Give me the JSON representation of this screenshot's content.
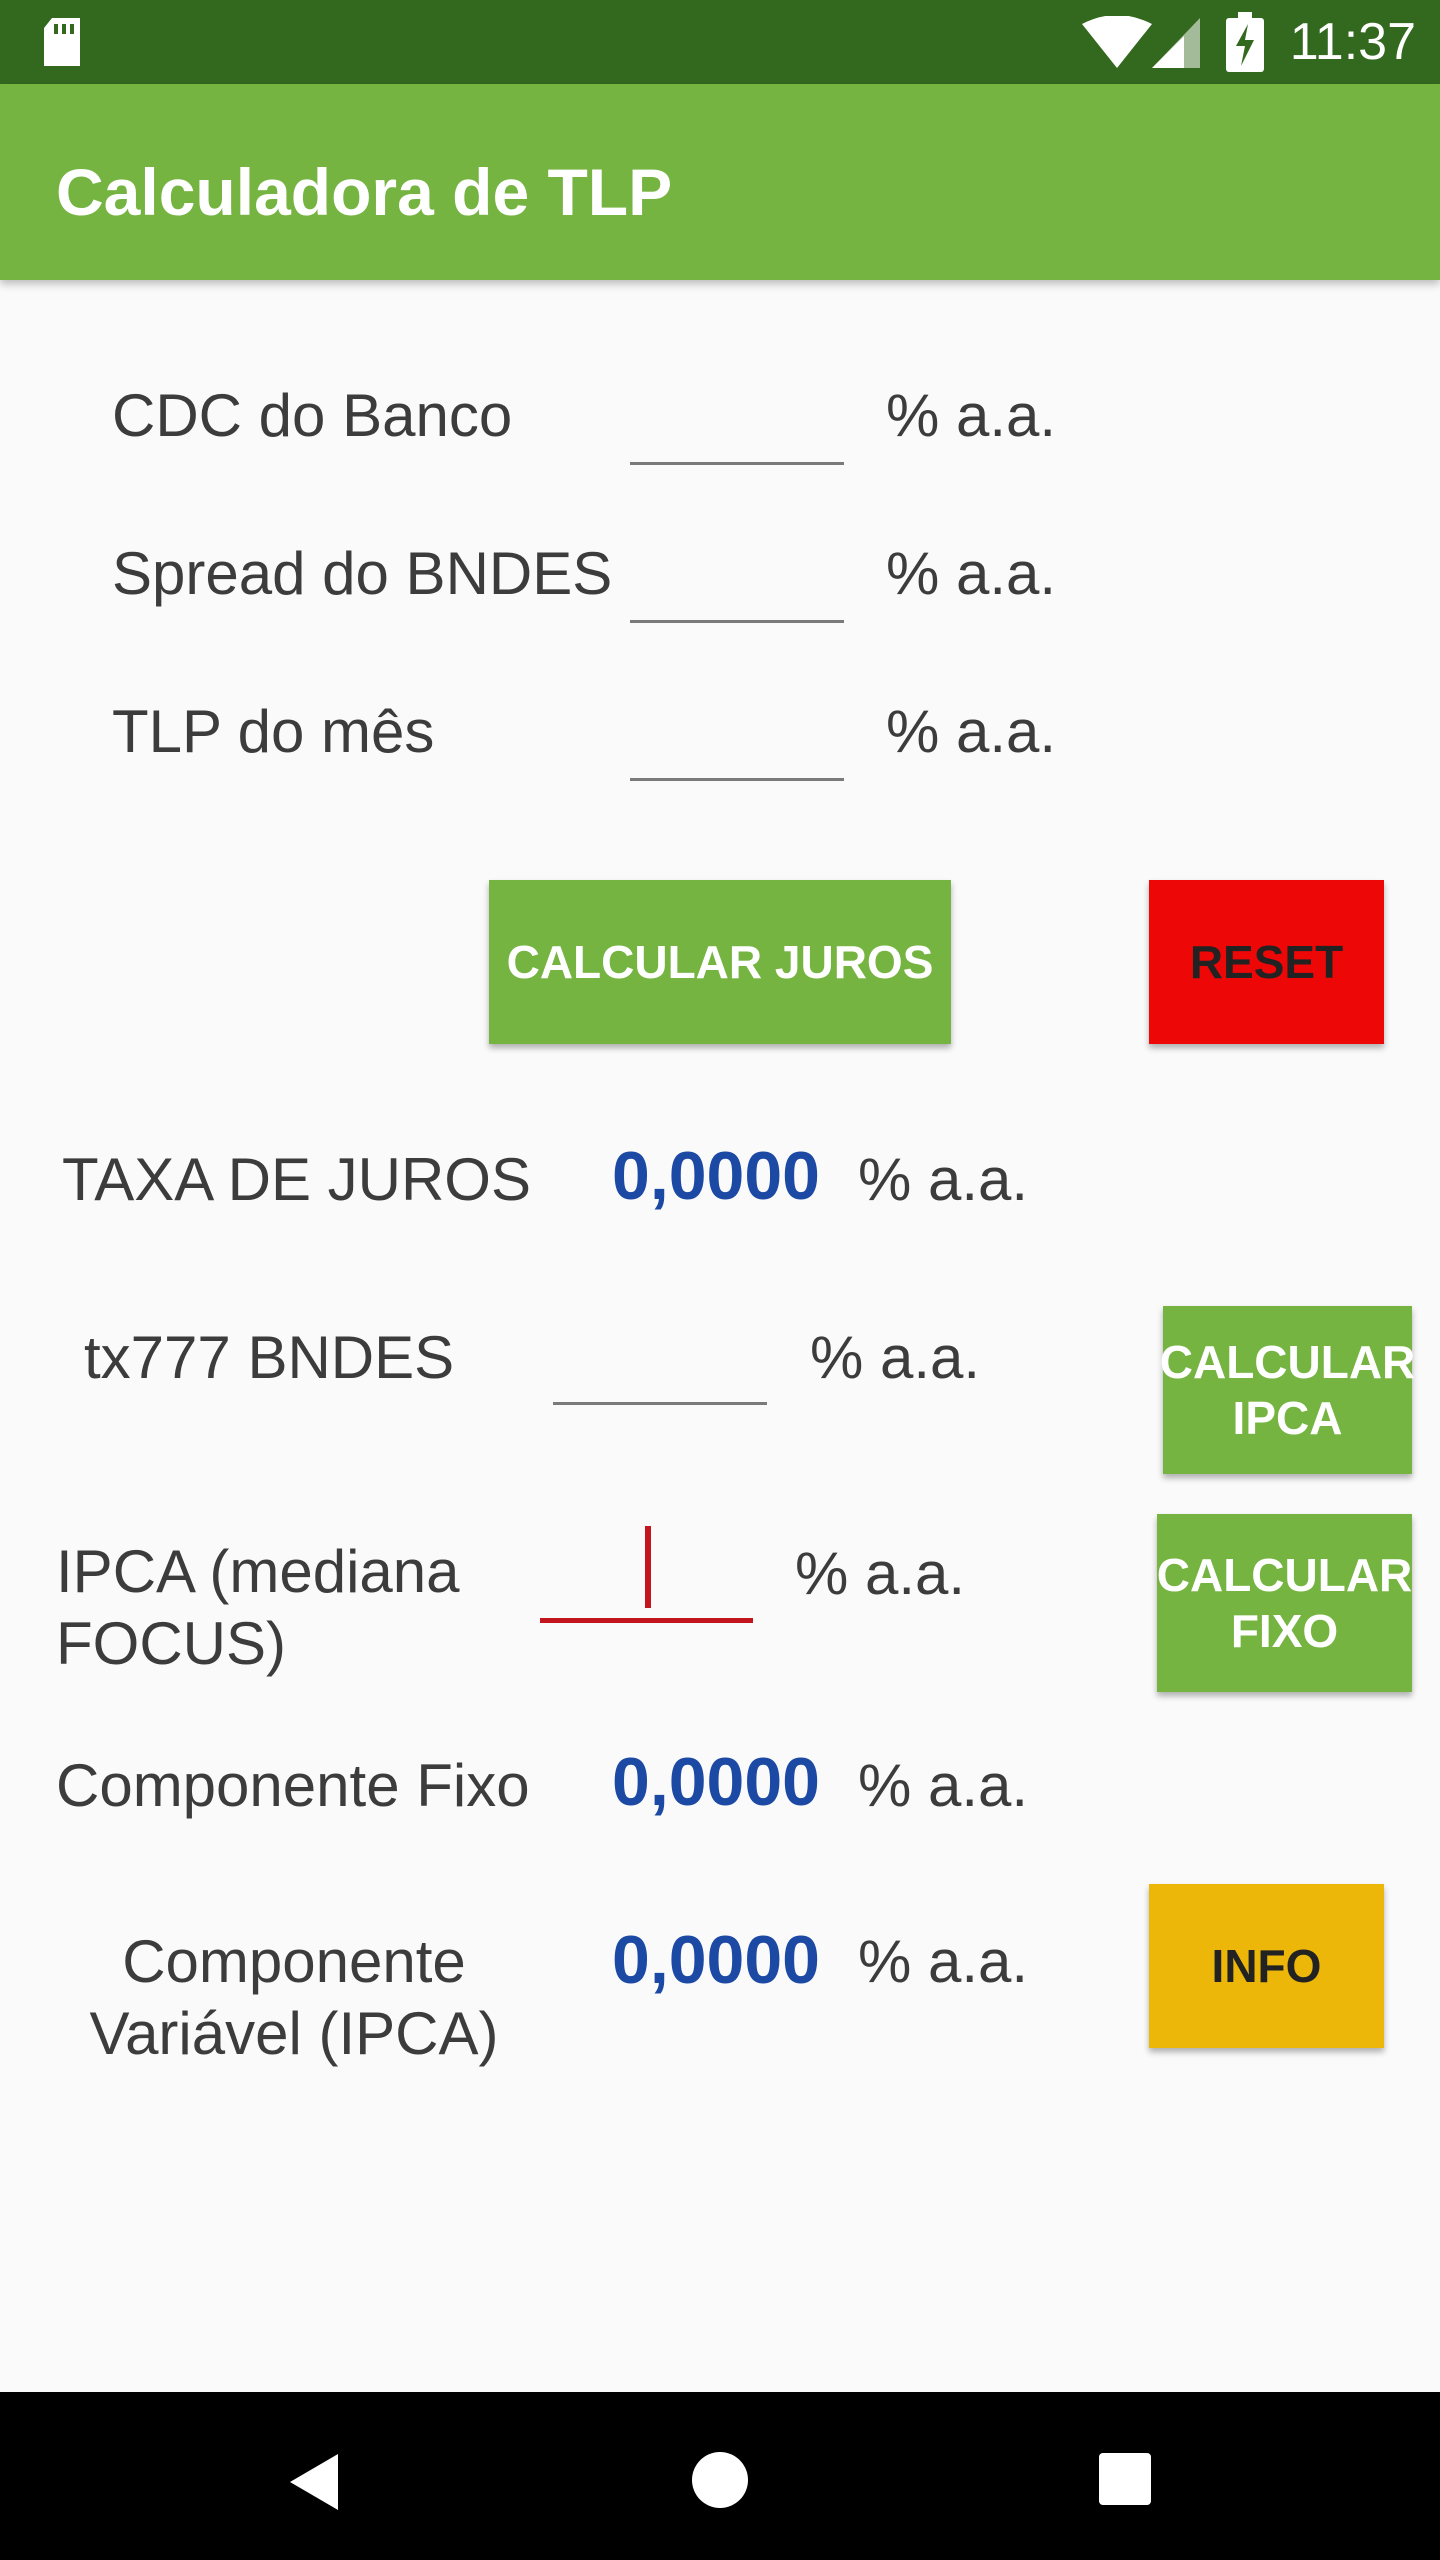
{
  "status_bar": {
    "time": "11:37"
  },
  "app_bar": {
    "title": "Calculadora de TLP"
  },
  "form": {
    "cdc_label": "CDC do Banco",
    "spread_label": "Spread do BNDES",
    "tlp_label": "TLP do mês",
    "unit": "% a.a."
  },
  "buttons": {
    "calcular_juros": "CALCULAR JUROS",
    "reset": "RESET",
    "calcular_ipca": "CALCULAR IPCA",
    "calcular_fixo": "CALCULAR FIXO",
    "info": "INFO"
  },
  "results": {
    "taxa_label": "TAXA DE JUROS",
    "taxa_value": "0,0000",
    "tx_label": "tx777 BNDES",
    "ipca_label": "IPCA (mediana FOCUS)",
    "fixo_label": "Componente Fixo",
    "fixo_value": "0,0000",
    "variavel_label": "Componente Variável (IPCA)",
    "variavel_value": "0,0000"
  },
  "colors": {
    "status_bar": "#33691e",
    "app_bar": "#76b442",
    "value_blue": "#1c49a3",
    "reset_red": "#ee0707",
    "info_yellow": "#ecb709"
  }
}
